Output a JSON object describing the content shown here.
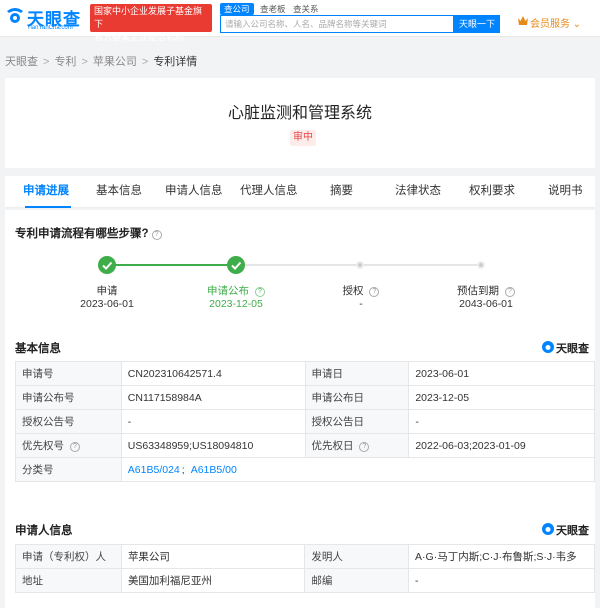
{
  "header": {
    "logo_text": "天眼查",
    "logo_sub": "TianYanCha.com",
    "banner_line1": "国家中小企业发展子基金旗下",
    "banner_line2": "官方备案企业征信机构",
    "search_tabs": [
      "查公司",
      "查老板",
      "查关系"
    ],
    "search_placeholder": "请输入公司名称、人名、品牌名称等关键词",
    "search_button": "天眼一下",
    "member_label": "会员服务",
    "member_caret": "⌄"
  },
  "breadcrumb": [
    "天眼查",
    "专利",
    "苹果公司",
    "专利详情"
  ],
  "patent": {
    "title": "心脏监测和管理系统",
    "status": "审中"
  },
  "tabs": [
    "申请进展",
    "基本信息",
    "申请人信息",
    "代理人信息",
    "摘要",
    "法律状态",
    "权利要求",
    "说明书"
  ],
  "progress": {
    "question": "专利申请流程有哪些步骤?",
    "steps": [
      {
        "label": "申请",
        "date": "2023-06-01",
        "done": true
      },
      {
        "label": "申请公布",
        "date": "2023-12-05",
        "done": true
      },
      {
        "label": "授权",
        "date": "-",
        "done": false
      },
      {
        "label": "预估到期",
        "date": "2043-06-01",
        "done": false
      }
    ]
  },
  "brand": "天眼查",
  "basic_info": {
    "title": "基本信息",
    "rows": [
      [
        "申请号",
        "CN202310642571.4",
        "申请日",
        "2023-06-01"
      ],
      [
        "申请公布号",
        "CN117158984A",
        "申请公布日",
        "2023-12-05"
      ],
      [
        "授权公告号",
        "-",
        "授权公告日",
        "-"
      ],
      [
        "优先权号",
        "US63348959;US18094810",
        "优先权日",
        "2022-06-03;2023-01-09"
      ]
    ],
    "class_label": "分类号",
    "class_values": [
      "A61B5/024",
      "A61B5/00"
    ]
  },
  "applicant_info": {
    "title": "申请人信息",
    "rows": [
      [
        "申请（专利权）人",
        "苹果公司",
        "发明人",
        "A·G·马丁内斯;C·J·布鲁斯;S·J·韦多"
      ],
      [
        "地址",
        "美国加利福尼亚州",
        "邮编",
        "-"
      ]
    ]
  },
  "colors": {
    "accent": "#0084ff",
    "done": "#3fae4a",
    "status_red": "#e64545",
    "banner_red": "#ea3b33"
  }
}
